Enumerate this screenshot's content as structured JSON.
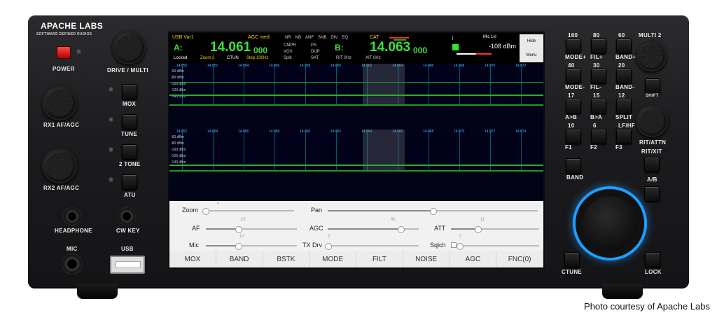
{
  "brand": {
    "name": "APACHE LABS",
    "tagline": "SOFTWARE DEFINED RADIOS"
  },
  "front_labels": {
    "power": "POWER",
    "drive": "DRIVE / MULTI",
    "mox": "MOX",
    "tune": "TUNE",
    "two_tone": "2 TONE",
    "atu": "ATU",
    "rx1": "RX1 AF/AGC",
    "rx2": "RX2 AF/AGC",
    "headphone": "HEADPHONE",
    "cwkey": "CW KEY",
    "mic": "MIC",
    "usb": "USB",
    "multi2": "MULTI 2",
    "shift": "SHIFT",
    "rit_attn": "RIT/ATTN",
    "rit_xit": "RIT/XIT",
    "band": "BAND",
    "ab": "A/B",
    "ctune": "CTUNE",
    "lock": "LOCK"
  },
  "right_keys": [
    {
      "top": "160",
      "bot": "MODE+"
    },
    {
      "top": "80",
      "bot": "FIL+"
    },
    {
      "top": "60",
      "bot": "BAND+"
    },
    {
      "top": "40",
      "bot": "MODE-"
    },
    {
      "top": "30",
      "bot": "FIL-"
    },
    {
      "top": "20",
      "bot": "BAND-"
    },
    {
      "top": "17",
      "bot": "A>B"
    },
    {
      "top": "15",
      "bot": "B>A"
    },
    {
      "top": "12",
      "bot": "SPLIT"
    },
    {
      "top": "10",
      "bot": "F1"
    },
    {
      "top": "6",
      "bot": "F2"
    },
    {
      "top": "LF/HF",
      "bot": "F3"
    }
  ],
  "screen": {
    "vfo_label": "USB Var1",
    "agc": "AGC med",
    "flags_row1": [
      "NR",
      "NB",
      "ANF",
      "SNB",
      "DIV",
      "EQ"
    ],
    "cat": "CAT",
    "vfoA_letter": "A:",
    "vfoA_main": "14.061",
    "vfoA_sub": "000",
    "vfoA_status": [
      "Locked",
      "Zoom 2",
      "CTUN",
      "Step 100Hz"
    ],
    "mid_col1": [
      "CMPR",
      "VOX",
      "Split"
    ],
    "mid_col2": [
      "PS",
      "DUP",
      "SAT"
    ],
    "rit": "RIT 0Hz",
    "xit": "XIT 0Hz",
    "vfoB_letter": "B:",
    "vfoB_main": "14.063",
    "vfoB_sub": "000",
    "mic_lvl": "Mic Lvl",
    "dbm": "-108 dBm",
    "hide": "Hide",
    "menu": "Menu",
    "ticks1": [
      "14.050",
      "14.052",
      "14.054",
      "14.056",
      "14.058",
      "14.060",
      "14.062",
      "14.064",
      "14.066",
      "14.068",
      "14.070",
      "14.072"
    ],
    "ticks2": [
      "14.052",
      "14.054",
      "14.056",
      "14.058",
      "14.060",
      "14.062",
      "14.064",
      "14.066",
      "14.068",
      "14.070",
      "14.072",
      "14.074"
    ],
    "db1": [
      "-60 dBm",
      "-80 dBm",
      "-100 dBm",
      "-120 dBm",
      "-140 dBm"
    ],
    "db2": [
      "-60 dBm",
      "-80 dBm",
      "-100 dBm",
      "-120 dBm",
      "-140 dBm"
    ]
  },
  "controls": {
    "zoom": {
      "label": "Zoom",
      "value": "2",
      "level": 0.02
    },
    "pan": {
      "label": "Pan",
      "level": 0.5
    },
    "af": {
      "label": "AF",
      "value": "-23",
      "level": 0.35
    },
    "agc": {
      "label": "AGC",
      "value": "80",
      "level": 0.8
    },
    "att": {
      "label": "ATT",
      "value": "11",
      "level": 0.3
    },
    "mic": {
      "label": "Mic",
      "value": "12",
      "level": 0.35
    },
    "txdrv": {
      "label": "TX Drv",
      "value": "0",
      "level": 0.0
    },
    "sqlch": {
      "label": "Sqlch",
      "value": "0",
      "level": 0.0
    }
  },
  "function_bar": [
    "MOX",
    "BAND",
    "BSTK",
    "MODE",
    "FILT",
    "NOISE",
    "AGC",
    "FNC(0)"
  ],
  "caption": "Photo courtesy of Apache Labs"
}
